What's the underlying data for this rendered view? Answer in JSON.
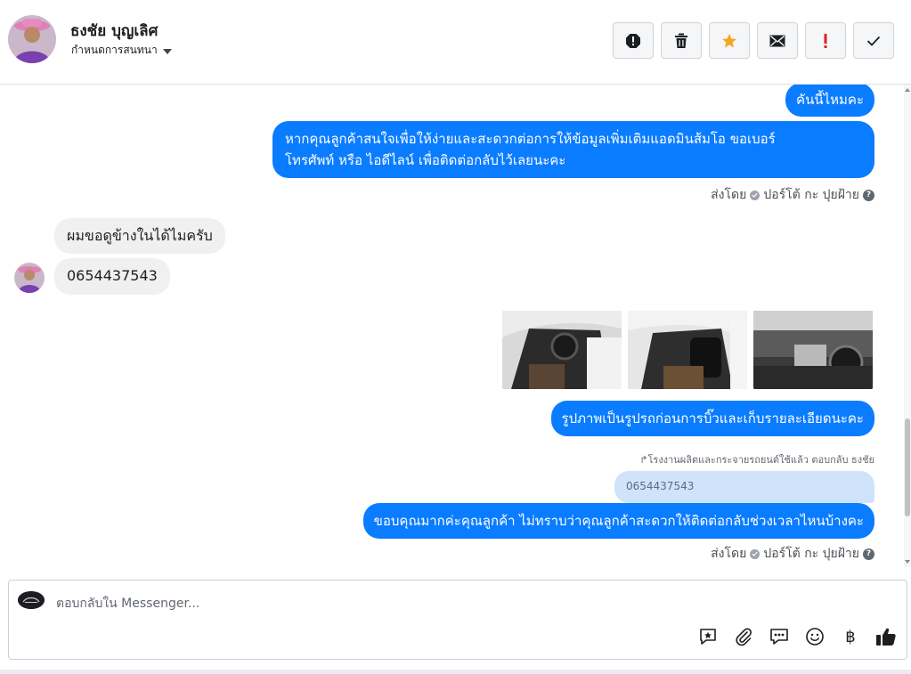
{
  "header": {
    "contact_name": "ธงชัย บุญเลิศ",
    "assign_label": "กำหนดการสนทนา",
    "actions": [
      {
        "name": "spam-icon"
      },
      {
        "name": "trash-icon"
      },
      {
        "name": "star-icon",
        "color": "#f5a623"
      },
      {
        "name": "mail-icon"
      },
      {
        "name": "important-icon",
        "color": "#e02020"
      },
      {
        "name": "done-check-icon"
      }
    ]
  },
  "conversation": {
    "msg1": "คันนี้ไหมคะ",
    "msg2_line1": "หากคุณลูกค้าสนใจเพื่อให้ง่ายและสะดวกต่อการให้ข้อมูลเพิ่มเติมแอดมินส้มโอ ขอเบอร์",
    "msg2_line2": "โทรศัพท์ หรือ ไอดีไลน์ เพื่อติดต่อกลับไว้เลยนะคะ",
    "sent_by_1": "ส่งโดย",
    "sender_1": "ปอร์โต้ กะ ปุยฝ้าย",
    "in_msg1": "ผมขอดูข้างในได้ไมครับ",
    "in_msg2": "0654437543",
    "msg3": "รูปภาพเป็นรูปรถก่อนการบิ๊วและเก็บรายละเอียดนะคะ",
    "reply_note": "↱โรงงานผลิตและกระจายรถยนต์ใช้แล้ว ตอบกลับ ธงชัย",
    "quoted_text": "0654437543",
    "msg4": "ขอบคุณมากค่ะคุณลูกค้า ไม่ทราบว่าคุณลูกค้าสะดวกให้ติดต่อกลับช่วงเวลาไหนบ้างคะ",
    "sent_by_2": "ส่งโดย",
    "sender_2": "ปอร์โต้ กะ ปุยฝ้าย",
    "outgoing_color": "#0a7cff"
  },
  "composer": {
    "placeholder": "ตอบกลับใน Messenger...",
    "currency_symbol": "฿",
    "tools": [
      "saved-reply-icon",
      "attachment-icon",
      "chat-bubbles-icon",
      "emoji-icon",
      "currency-icon",
      "like-icon"
    ]
  }
}
